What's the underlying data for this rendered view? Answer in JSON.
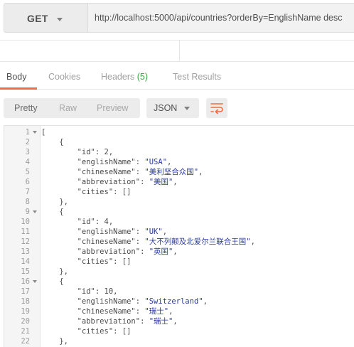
{
  "request": {
    "method": "GET",
    "url": "http://localhost:5000/api/countries?orderBy=EnglishName desc"
  },
  "response_tabs": [
    {
      "label": "Body",
      "active": true
    },
    {
      "label": "Cookies",
      "active": false
    },
    {
      "label": "Headers",
      "count": "(5)",
      "active": false
    },
    {
      "label": "Test Results",
      "active": false
    }
  ],
  "toolbar": {
    "format_buttons": [
      "Pretty",
      "Raw",
      "Preview"
    ],
    "selected_format": "Pretty",
    "language": "JSON",
    "wrap_icon": "wrap-lines-icon"
  },
  "colors": {
    "accent": "#f26b3a",
    "count": "#3aa54a",
    "string": "#2a3aa0"
  },
  "code_lines": [
    {
      "n": "1",
      "fold": true,
      "text": "["
    },
    {
      "n": "2",
      "fold": false,
      "text": "    {"
    },
    {
      "n": "3",
      "fold": false,
      "text": "        \"id\": 2,"
    },
    {
      "n": "4",
      "fold": false,
      "text": "        \"englishName\": \"USA\","
    },
    {
      "n": "5",
      "fold": false,
      "text": "        \"chineseName\": \"美利坚合众国\","
    },
    {
      "n": "6",
      "fold": false,
      "text": "        \"abbreviation\": \"美国\","
    },
    {
      "n": "7",
      "fold": false,
      "text": "        \"cities\": []"
    },
    {
      "n": "8",
      "fold": false,
      "text": "    },"
    },
    {
      "n": "9",
      "fold": true,
      "text": "    {"
    },
    {
      "n": "10",
      "fold": false,
      "text": "        \"id\": 4,"
    },
    {
      "n": "11",
      "fold": false,
      "text": "        \"englishName\": \"UK\","
    },
    {
      "n": "12",
      "fold": false,
      "text": "        \"chineseName\": \"大不列颠及北爱尔兰联合王国\","
    },
    {
      "n": "13",
      "fold": false,
      "text": "        \"abbreviation\": \"英国\","
    },
    {
      "n": "14",
      "fold": false,
      "text": "        \"cities\": []"
    },
    {
      "n": "15",
      "fold": false,
      "text": "    },"
    },
    {
      "n": "16",
      "fold": true,
      "text": "    {"
    },
    {
      "n": "17",
      "fold": false,
      "text": "        \"id\": 10,"
    },
    {
      "n": "18",
      "fold": false,
      "text": "        \"englishName\": \"Switzerland\","
    },
    {
      "n": "19",
      "fold": false,
      "text": "        \"chineseName\": \"瑞士\","
    },
    {
      "n": "20",
      "fold": false,
      "text": "        \"abbreviation\": \"瑞士\","
    },
    {
      "n": "21",
      "fold": false,
      "text": "        \"cities\": []"
    },
    {
      "n": "22",
      "fold": false,
      "text": "    },"
    }
  ]
}
